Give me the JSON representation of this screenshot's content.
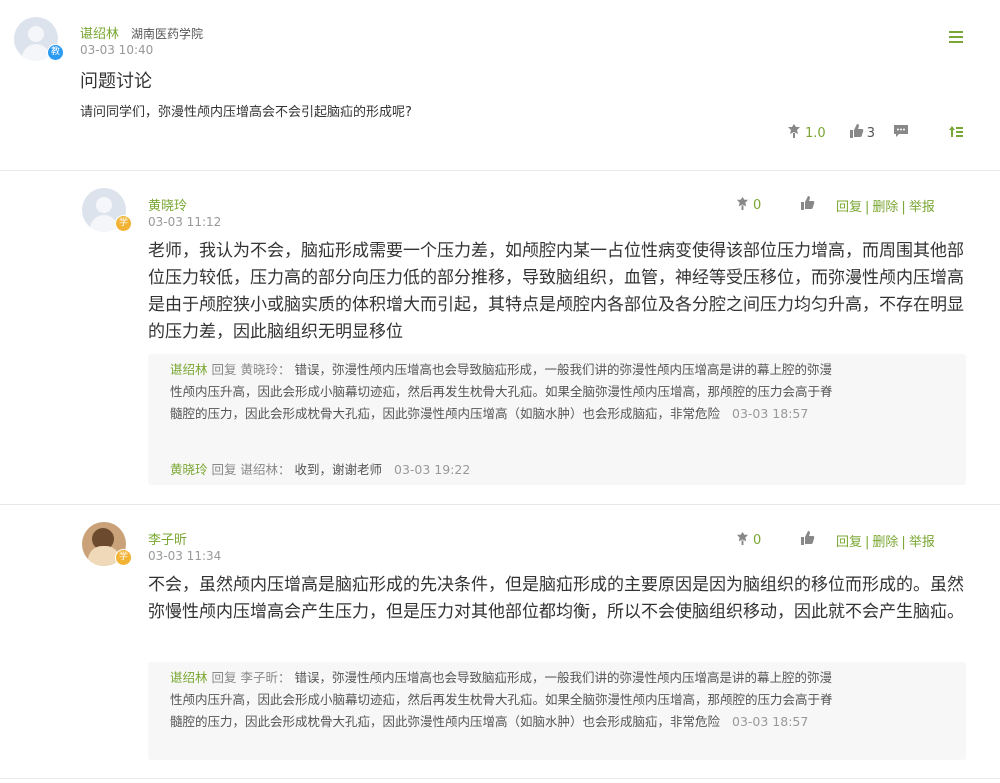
{
  "post": {
    "author": "谌绍林",
    "school": "湖南医药学院",
    "time": "03-03 10:40",
    "badge": "教",
    "title": "问题讨论",
    "content": "请问同学们，弥漫性颅内压增高会不会引起脑疝的形成呢?",
    "score": "1.0",
    "likes": "3"
  },
  "replies": [
    {
      "author": "黄晓玲",
      "badge": "学",
      "time": "03-03 11:12",
      "score": "0",
      "actions": {
        "reply": "回复",
        "delete": "删除",
        "report": "举报"
      },
      "text": "老师，我认为不会，脑疝形成需要一个压力差，如颅腔内某一占位性病变使得该部位压力增高，而周围其他部位压力较低，压力高的部分向压力低的部分推移，导致脑组织，血管，神经等受压移位，而弥漫性颅内压增高是由于颅腔狭小或脑实质的体积增大而引起，其特点是颅腔内各部位及各分腔之间压力均匀升高，不存在明显的压力差，因此脑组织无明显移位",
      "comments": [
        {
          "from": "谌绍林",
          "verb": "回复",
          "to": "黄晓玲：",
          "text": "错误，弥漫性颅内压增高也会导致脑疝形成，一般我们讲的弥漫性颅内压增高是讲的幕上腔的弥漫性颅内压升高，因此会形成小脑幕切迹疝，然后再发生枕骨大孔疝。如果全脑弥漫性颅内压增高，那颅腔的压力会高于脊髓腔的压力，因此会形成枕骨大孔疝，因此弥漫性颅内压增高（如脑水肿）也会形成脑疝，非常危险",
          "time": "03-03 18:57"
        },
        {
          "from": "黄晓玲",
          "verb": "回复",
          "to": "谌绍林：",
          "text": "收到，谢谢老师",
          "time": "03-03 19:22"
        }
      ]
    },
    {
      "author": "李子昕",
      "badge": "学",
      "time": "03-03 11:34",
      "score": "0",
      "actions": {
        "reply": "回复",
        "delete": "删除",
        "report": "举报"
      },
      "text": "不会，虽然颅内压增高是脑疝形成的先决条件，但是脑疝形成的主要原因是因为脑组织的移位而形成的。虽然弥慢性颅内压增高会产生压力，但是压力对其他部位都均衡，所以不会使脑组织移动，因此就不会产生脑疝。",
      "comments": [
        {
          "from": "谌绍林",
          "verb": "回复",
          "to": "李子昕：",
          "text": "错误，弥漫性颅内压增高也会导致脑疝形成，一般我们讲的弥漫性颅内压增高是讲的幕上腔的弥漫性颅内压升高，因此会形成小脑幕切迹疝，然后再发生枕骨大孔疝。如果全脑弥漫性颅内压增高，那颅腔的压力会高于脊髓腔的压力，因此会形成枕骨大孔疝，因此弥漫性颅内压增高（如脑水肿）也会形成脑疝，非常危险",
          "time": "03-03 18:57"
        }
      ]
    }
  ],
  "icons": {
    "award": "award-icon",
    "like": "thumbs-up-icon",
    "comment": "comment-icon",
    "menu": "menu-icon",
    "top": "pin-top-icon"
  },
  "colors": {
    "accent": "#7aa733",
    "teacher_badge": "#2b9af3",
    "student_badge": "#f2b233"
  }
}
